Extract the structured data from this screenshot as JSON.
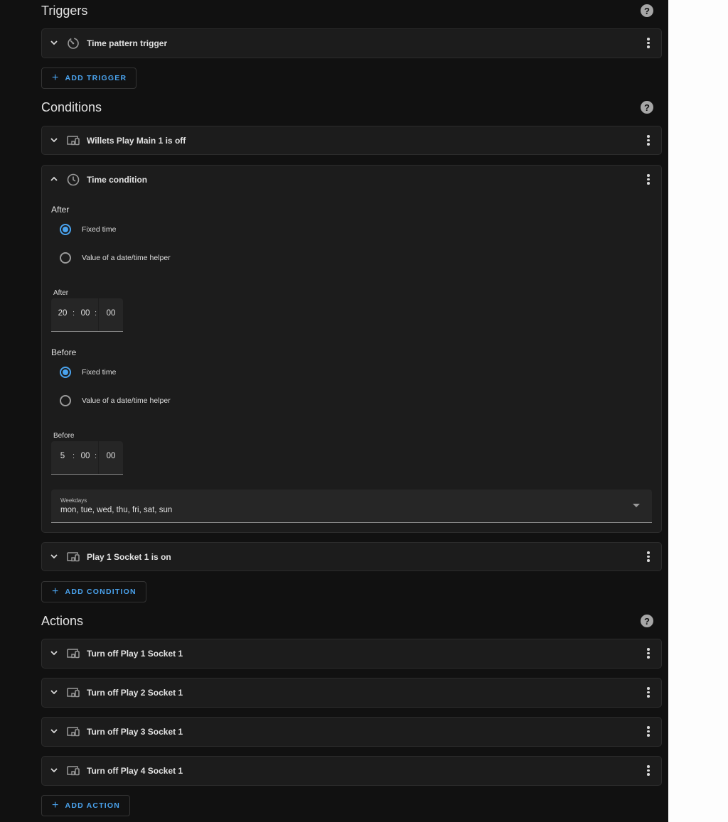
{
  "triggers": {
    "title": "Triggers",
    "help_icon": "help-circle-icon",
    "items": [
      {
        "title": "Time pattern trigger",
        "icon": "timer-outline-icon"
      }
    ],
    "add_label": "ADD TRIGGER"
  },
  "conditions": {
    "title": "Conditions",
    "help_icon": "help-circle-icon",
    "device_condition": {
      "title": "Willets Play Main 1 is off",
      "icon": "devices-icon"
    },
    "time_condition": {
      "title": "Time condition",
      "icon": "clock-outline-icon",
      "after": {
        "heading": "After",
        "option_fixed": "Fixed time",
        "option_helper": "Value of a date/time helper",
        "selected": "fixed",
        "field_label": "After",
        "hours": "20",
        "minutes": "00",
        "seconds": "00"
      },
      "before": {
        "heading": "Before",
        "option_fixed": "Fixed time",
        "option_helper": "Value of a date/time helper",
        "selected": "fixed",
        "field_label": "Before",
        "hours": "5",
        "minutes": "00",
        "seconds": "00"
      },
      "weekdays": {
        "label": "Weekdays",
        "value": "mon, tue, wed, thu, fri, sat, sun"
      }
    },
    "socket_condition": {
      "title": "Play 1 Socket 1 is on",
      "icon": "devices-icon"
    },
    "add_label": "ADD CONDITION"
  },
  "actions": {
    "title": "Actions",
    "help_icon": "help-circle-icon",
    "items": [
      {
        "title": "Turn off Play 1 Socket 1",
        "icon": "devices-icon"
      },
      {
        "title": "Turn off Play 2 Socket 1",
        "icon": "devices-icon"
      },
      {
        "title": "Turn off Play 3 Socket 1",
        "icon": "devices-icon"
      },
      {
        "title": "Turn off Play 4 Socket 1",
        "icon": "devices-icon"
      }
    ],
    "add_label": "ADD ACTION"
  },
  "colors": {
    "background": "#111111",
    "card": "#1c1c1c",
    "accent": "#4aa3ee",
    "text": "#e1e1e1"
  }
}
